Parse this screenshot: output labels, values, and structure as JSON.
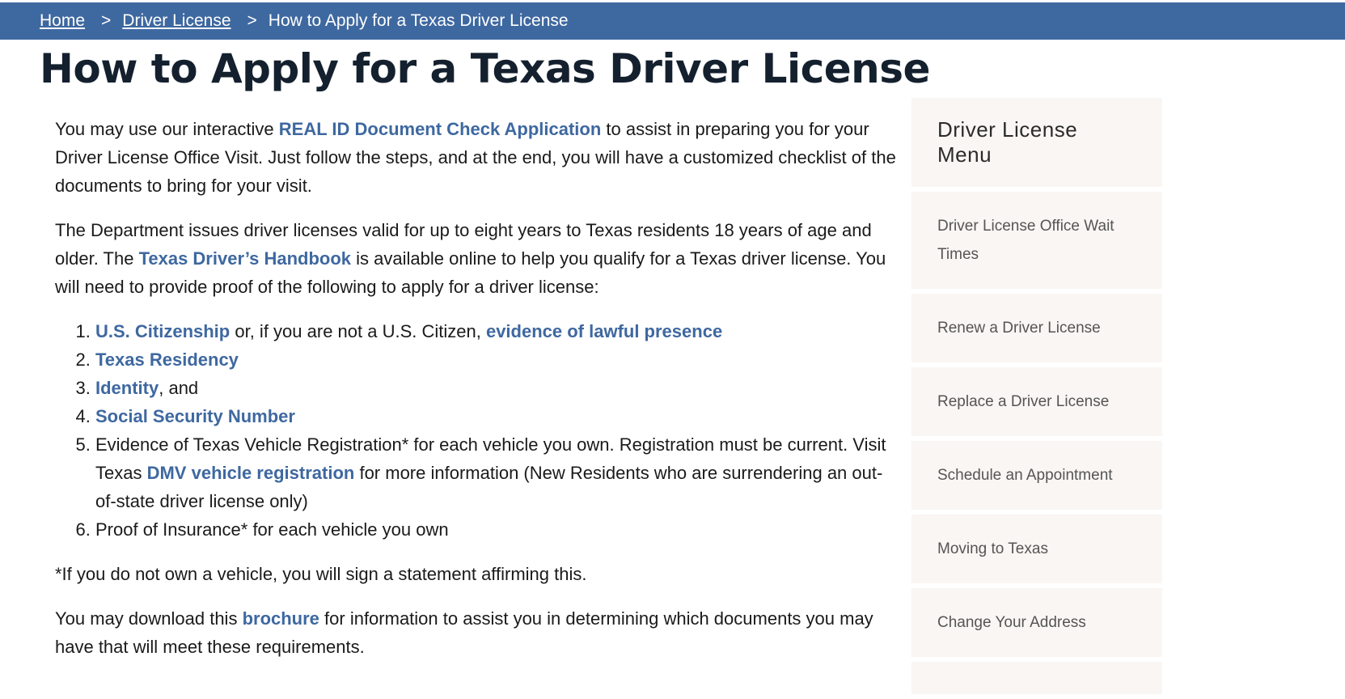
{
  "breadcrumb": {
    "home": "Home",
    "separator": ">",
    "driver_license": "Driver License",
    "current": "How to Apply for a Texas Driver License"
  },
  "page_title": "How to Apply for a Texas Driver License",
  "intro": {
    "before": "You may use our interactive ",
    "link": "REAL ID Document Check Application",
    "after": " to assist in preparing you for your Driver License Office Visit. Just follow the steps, and at the end, you will have a customized checklist of the documents to bring for your visit."
  },
  "para2": {
    "before": "The Department issues driver licenses valid for up to eight years to Texas residents 18 years of age and older. The ",
    "link": "Texas Driver’s Handbook",
    "after": " is available online to help you qualify for a Texas driver license. You will need to provide proof of the following to apply for a driver license:"
  },
  "requirements": {
    "item1": {
      "link1": "U.S. Citizenship",
      "middle": " or, if you are not a U.S. Citizen, ",
      "link2": "evidence of lawful presence"
    },
    "item2": {
      "link": "Texas Residency"
    },
    "item3": {
      "link": "Identity",
      "after": ", and"
    },
    "item4": {
      "link": "Social Security Number"
    },
    "item5": {
      "before": "Evidence of Texas Vehicle Registration* for each vehicle you own. Registration must be current. Visit Texas ",
      "link": "DMV vehicle registration",
      "after": " for more information (New Residents who are surrendering an out-of-state driver license only)"
    },
    "item6": {
      "text": "Proof of Insurance* for each vehicle you own"
    }
  },
  "footnote": "*If you do not own a vehicle, you will sign a statement affirming this.",
  "brochure": {
    "before": "You may download this ",
    "link": "brochure",
    "after": " for information to assist you in determining which documents you may have that will meet these requirements."
  },
  "sidebar": {
    "title": "Driver License Menu",
    "items": [
      {
        "label": "Driver License Office Wait Times"
      },
      {
        "label": "Renew a Driver License"
      },
      {
        "label": "Replace a Driver License"
      },
      {
        "label": "Schedule an Appointment"
      },
      {
        "label": "Moving to Texas"
      },
      {
        "label": "Change Your Address"
      }
    ]
  },
  "colors": {
    "breadcrumb_bg": "#3e68a0",
    "link": "#3e68a0",
    "title": "#14202e",
    "sidebar_bg": "#faf6f3"
  }
}
